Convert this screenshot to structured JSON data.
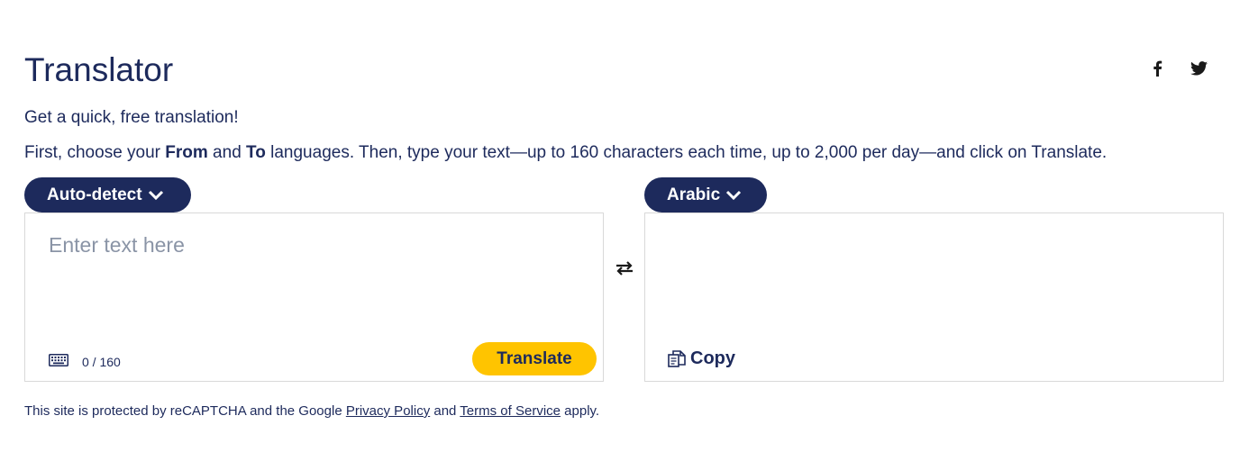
{
  "header": {
    "title": "Translator"
  },
  "social": [
    {
      "name": "facebook-icon"
    },
    {
      "name": "twitter-icon"
    }
  ],
  "intro": {
    "subtitle": "Get a quick, free translation!",
    "part1": "First, choose your ",
    "from_word": "From",
    "part2": " and ",
    "to_word": "To",
    "part3": " languages. Then, type your text—up to 160 characters each time, up to 2,000 per day—and click on Translate."
  },
  "source": {
    "language": "Auto-detect",
    "placeholder": "Enter text here",
    "value": "",
    "counter": "0 / 160",
    "translate_label": "Translate"
  },
  "target": {
    "language": "Arabic",
    "copy_label": "Copy"
  },
  "footer": {
    "text1": "This site is protected by reCAPTCHA and the Google ",
    "privacy_link": "Privacy Policy",
    "text2": " and ",
    "terms_link": "Terms of Service",
    "text3": " apply."
  },
  "colors": {
    "primary": "#1d2a5c",
    "accent": "#ffc400",
    "border": "#d9d9d9",
    "placeholder": "#8a94a6"
  }
}
